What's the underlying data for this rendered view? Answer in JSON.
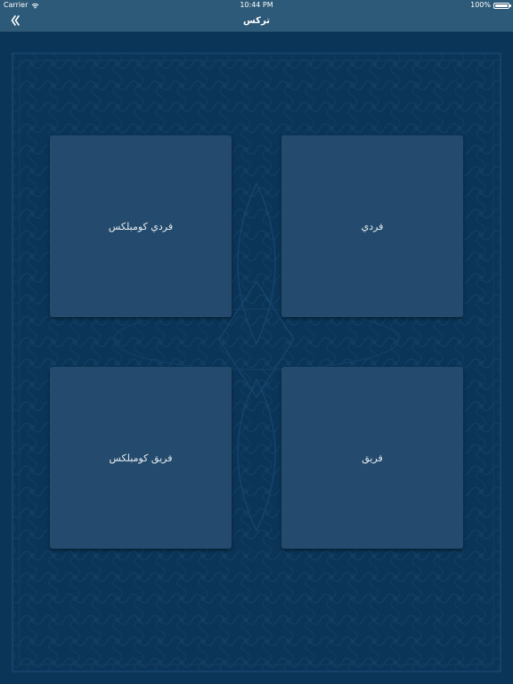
{
  "status_bar": {
    "carrier": "Carrier",
    "time": "10:44 PM",
    "battery_text": "100%",
    "battery_level": 1.0
  },
  "nav": {
    "title": "تركس",
    "back_icon": "double-chevron-left-icon"
  },
  "colors": {
    "bar": "#2d5a78",
    "background": "#0b3558",
    "card": "#244b6d",
    "text": "#e3e9ef"
  },
  "cards": [
    {
      "label": "فردي كومبلكس"
    },
    {
      "label": "فردي"
    },
    {
      "label": "فريق كومبلكس"
    },
    {
      "label": "فريق"
    }
  ]
}
